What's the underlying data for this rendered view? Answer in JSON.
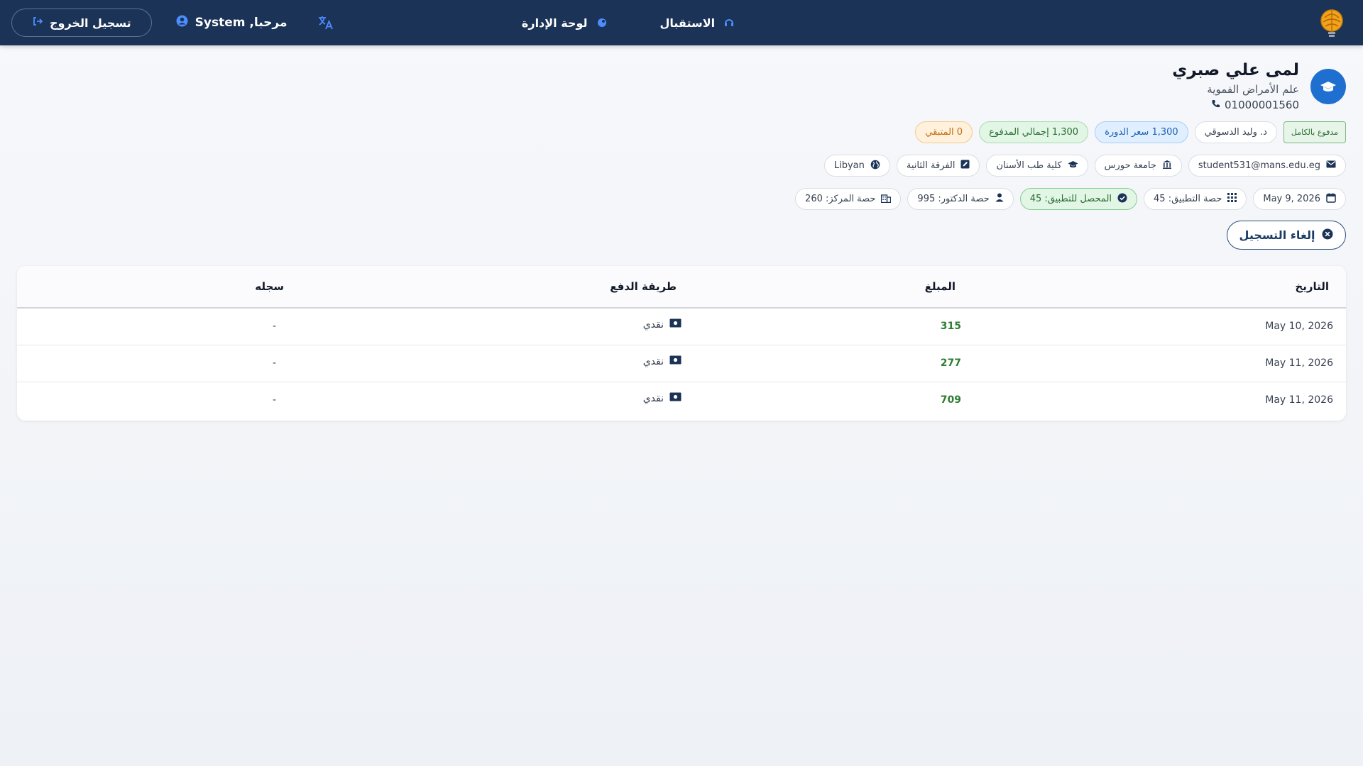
{
  "nav": {
    "reception_label": "الاستقبال",
    "dashboard_label": "لوحة الإدارة",
    "welcome_text": "مرحبا, System",
    "logout_label": "تسجيل الخروج"
  },
  "profile": {
    "name": "لمى علي صبري",
    "specialty": "علم الأمراض الفموية",
    "phone": "01000001560"
  },
  "chips_row1": {
    "paid_badge": "مدفوع بالكامل",
    "doctor": "د. وليد الدسوقي",
    "course_price": "1,300 سعر الدورة",
    "total_paid": "1,300 إجمالي المدفوع",
    "remaining": "0 المتبقي"
  },
  "chips_row2": {
    "email": "student531@mans.edu.eg",
    "university": "جامعة حورس",
    "faculty": "كلية طب الأسنان",
    "year": "الفرقة الثانية",
    "nationality": "Libyan"
  },
  "chips_row3": {
    "date": "May 9, 2026",
    "app_share": "حصة التطبيق: 45",
    "app_collected": "المحصل للتطبيق: 45",
    "doctor_share": "حصة الدكتور: 995",
    "center_share": "حصة المركز: 260"
  },
  "cancel_label": "إلغاء التسجيل",
  "table": {
    "headers": {
      "date": "التاريخ",
      "amount": "المبلغ",
      "method": "طريقة الدفع",
      "recorded_by": "سجله"
    },
    "rows": [
      {
        "date": "May 10, 2026",
        "amount": "315",
        "method": "نقدي",
        "recorded_by": "-"
      },
      {
        "date": "May 11, 2026",
        "amount": "277",
        "method": "نقدي",
        "recorded_by": "-"
      },
      {
        "date": "May 11, 2026",
        "amount": "709",
        "method": "نقدي",
        "recorded_by": "-"
      }
    ]
  },
  "colors": {
    "navbar": "#1b3356",
    "accent_blue": "#1f6fd1",
    "amount_green": "#2e7d32"
  }
}
